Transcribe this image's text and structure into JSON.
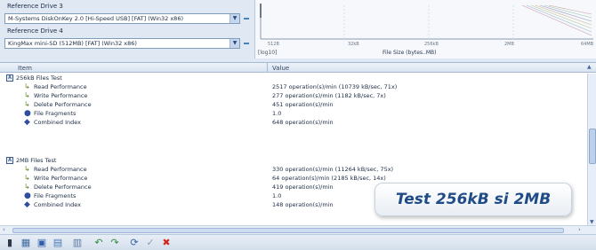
{
  "drives": [
    {
      "label": "Reference Drive 3",
      "value": "M-Systems DiskOnKey 2.0 [Hi-Speed USB] [FAT] (Win32 x86)"
    },
    {
      "label": "Reference Drive 4",
      "value": "KingMax mini-SD (512MB) [FAT] (Win32 x86)"
    }
  ],
  "graph": {
    "x_ticks": [
      "512B",
      "32kB",
      "256kB",
      "2MB",
      "64MB"
    ],
    "unit": "[log10]",
    "x_title": "File Size (bytes..MB)"
  },
  "table": {
    "col_item": "Item",
    "col_value": "Value",
    "groups": [
      {
        "title": "256kB Files Test",
        "rows": [
          {
            "name": "Read Performance",
            "value": "2517 operation(s)/min (10739 kB/sec, 71x)",
            "icon": "arrow-icon"
          },
          {
            "name": "Write Performance",
            "value": "277 operation(s)/min (1182 kB/sec, 7x)",
            "icon": "arrow-icon"
          },
          {
            "name": "Delete Performance",
            "value": "451 operation(s)/min",
            "icon": "arrow-icon"
          },
          {
            "name": "File Fragments",
            "value": "1.0",
            "icon": "info-icon"
          },
          {
            "name": "Combined Index",
            "value": "648 operation(s)/min",
            "icon": "diamond-icon"
          }
        ]
      },
      {
        "title": "2MB Files Test",
        "rows": [
          {
            "name": "Read Performance",
            "value": "330 operation(s)/min (11264 kB/sec, 75x)",
            "icon": "arrow-icon"
          },
          {
            "name": "Write Performance",
            "value": "64 operation(s)/min (2185 kB/sec, 14x)",
            "icon": "arrow-icon"
          },
          {
            "name": "Delete Performance",
            "value": "419 operation(s)/min",
            "icon": "arrow-icon"
          },
          {
            "name": "File Fragments",
            "value": "1.0",
            "icon": "info-icon"
          },
          {
            "name": "Combined Index",
            "value": "148 operation(s)/min",
            "icon": "diamond-icon"
          }
        ]
      }
    ]
  },
  "caption": "Test 256kB si 2MB",
  "toolbar": [
    "copy-icon",
    "copy-all-icon",
    "save-icon",
    "view-icon",
    "chart-icon",
    "back-icon",
    "forward-icon",
    "refresh-icon",
    "check-icon",
    "delete-icon"
  ]
}
